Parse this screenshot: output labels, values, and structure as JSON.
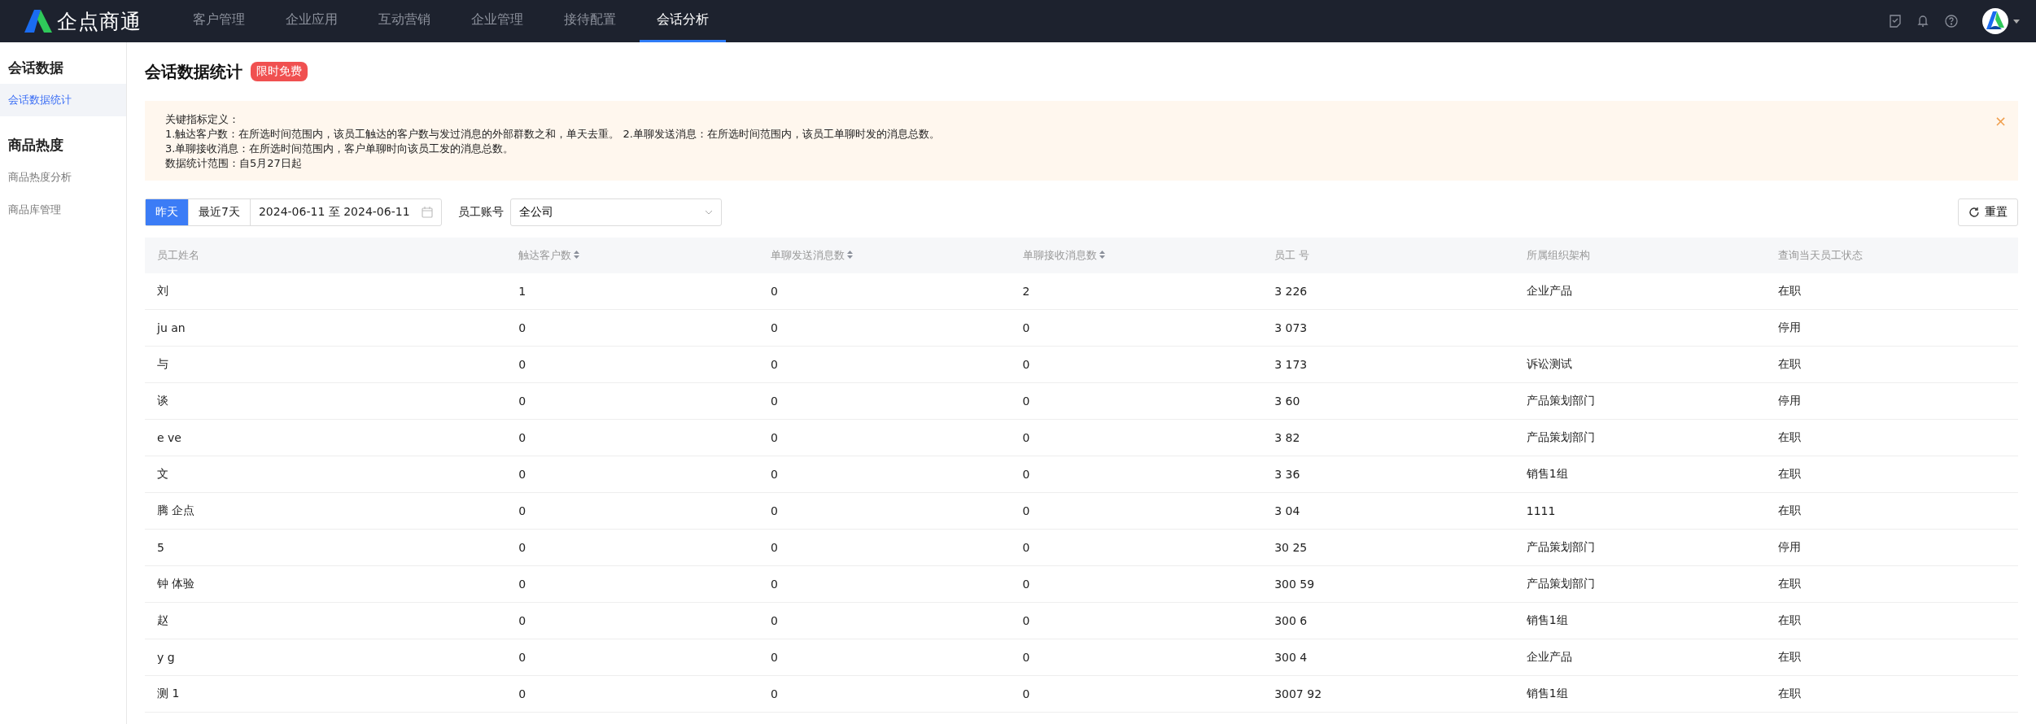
{
  "brand": "企点商通",
  "nav": [
    {
      "label": "客户管理",
      "selected": false
    },
    {
      "label": "企业应用",
      "selected": false
    },
    {
      "label": "互动营销",
      "selected": false
    },
    {
      "label": "企业管理",
      "selected": false
    },
    {
      "label": "接待配置",
      "selected": false
    },
    {
      "label": "会话分析",
      "selected": true
    }
  ],
  "sidebar": [
    {
      "title": "会话数据",
      "items": [
        {
          "label": "会话数据统计",
          "selected": true
        }
      ]
    },
    {
      "title": "商品热度",
      "items": [
        {
          "label": "商品热度分析",
          "selected": false
        },
        {
          "label": "商品库管理",
          "selected": false
        }
      ]
    }
  ],
  "page": {
    "title": "会话数据统计",
    "badge": "限时免费"
  },
  "notice": {
    "lines": [
      "关键指标定义：",
      "1.触达客户数：在所选时间范围内，该员工触达的客户数与发过消息的外部群数之和，单天去重。 2.单聊发送消息：在所选时间范围内，该员工单聊时发的消息总数。",
      "3.单聊接收消息：在所选时间范围内，客户单聊时向该员工发的消息总数。",
      "数据统计范围：自5月27日起"
    ],
    "close": "×"
  },
  "filters": {
    "ranges": [
      {
        "label": "昨天",
        "selected": true
      },
      {
        "label": "最近7天",
        "selected": false
      }
    ],
    "date_range": "2024-06-11 至 2024-06-11",
    "account_label": "员工账号",
    "account_value": "全公司",
    "reset": "重置"
  },
  "table": {
    "columns": [
      {
        "label": "员工姓名",
        "sortable": false
      },
      {
        "label": "触达客户数",
        "sortable": true
      },
      {
        "label": "单聊发送消息数",
        "sortable": true
      },
      {
        "label": "单聊接收消息数",
        "sortable": true
      },
      {
        "label": "员工 号",
        "sortable": false
      },
      {
        "label": "所属组织架构",
        "sortable": false
      },
      {
        "label": "查询当天员工状态",
        "sortable": false
      }
    ],
    "rows": [
      [
        "刘",
        "1",
        "0",
        "2",
        "3 226",
        "企业产品",
        "在职"
      ],
      [
        "ju an",
        "0",
        "0",
        "0",
        "3 073",
        "",
        "停用"
      ],
      [
        "与",
        "0",
        "0",
        "0",
        "3 173",
        "诉讼测试",
        "在职"
      ],
      [
        "谈",
        "0",
        "0",
        "0",
        "3 60",
        "产品策划部门",
        "停用"
      ],
      [
        "e ve",
        "0",
        "0",
        "0",
        "3 82",
        "产品策划部门",
        "在职"
      ],
      [
        "文",
        "0",
        "0",
        "0",
        "3 36",
        "销售1组",
        "在职"
      ],
      [
        "腾 企点",
        "0",
        "0",
        "0",
        "3 04",
        "1111",
        "在职"
      ],
      [
        "5",
        "0",
        "0",
        "0",
        "30 25",
        "产品策划部门",
        "停用"
      ],
      [
        "钟 体验",
        "0",
        "0",
        "0",
        "300 59",
        "产品策划部门",
        "在职"
      ],
      [
        "赵",
        "0",
        "0",
        "0",
        "300 6",
        "销售1组",
        "在职"
      ],
      [
        "y g",
        "0",
        "0",
        "0",
        "300 4",
        "企业产品",
        "在职"
      ],
      [
        "测 1",
        "0",
        "0",
        "0",
        "3007 92",
        "销售1组",
        "在职"
      ]
    ]
  }
}
